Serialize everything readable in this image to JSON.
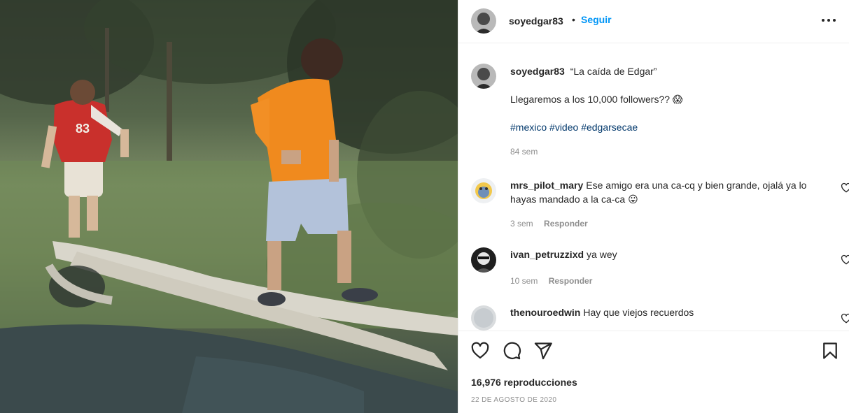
{
  "post": {
    "username": "soyedgar83",
    "separator": "•",
    "follow_label": "Seguir",
    "caption": {
      "username": "soyedgar83",
      "title": "“La caída de Edgar”",
      "line2": "Llegaremos a los 10,000 followers?? 😱",
      "hashtags": [
        "#mexico",
        "#video",
        "#edgarsecae"
      ],
      "time": "84 sem"
    },
    "comments": [
      {
        "username": "mrs_pilot_mary",
        "text": "Ese amigo era una ca-cq y bien grande, ojalá ya lo hayas mandado a la ca-ca 😛",
        "time": "3 sem",
        "reply_label": "Responder"
      },
      {
        "username": "ivan_petruzzixd",
        "text": "ya wey",
        "time": "10 sem",
        "reply_label": "Responder"
      },
      {
        "username": "thenouroedwin",
        "text": "Hay que viejos recuerdos"
      }
    ],
    "views": "16,976 reproducciones",
    "date": "22 DE AGOSTO DE 2020",
    "icons": {
      "more": "more-options-icon",
      "like": "heart-icon",
      "comment": "comment-icon",
      "share": "send-icon",
      "save": "bookmark-icon"
    },
    "colors": {
      "link_blue": "#0095f6",
      "hashtag": "#00376b",
      "secondary_text": "#8e8e8e"
    }
  }
}
